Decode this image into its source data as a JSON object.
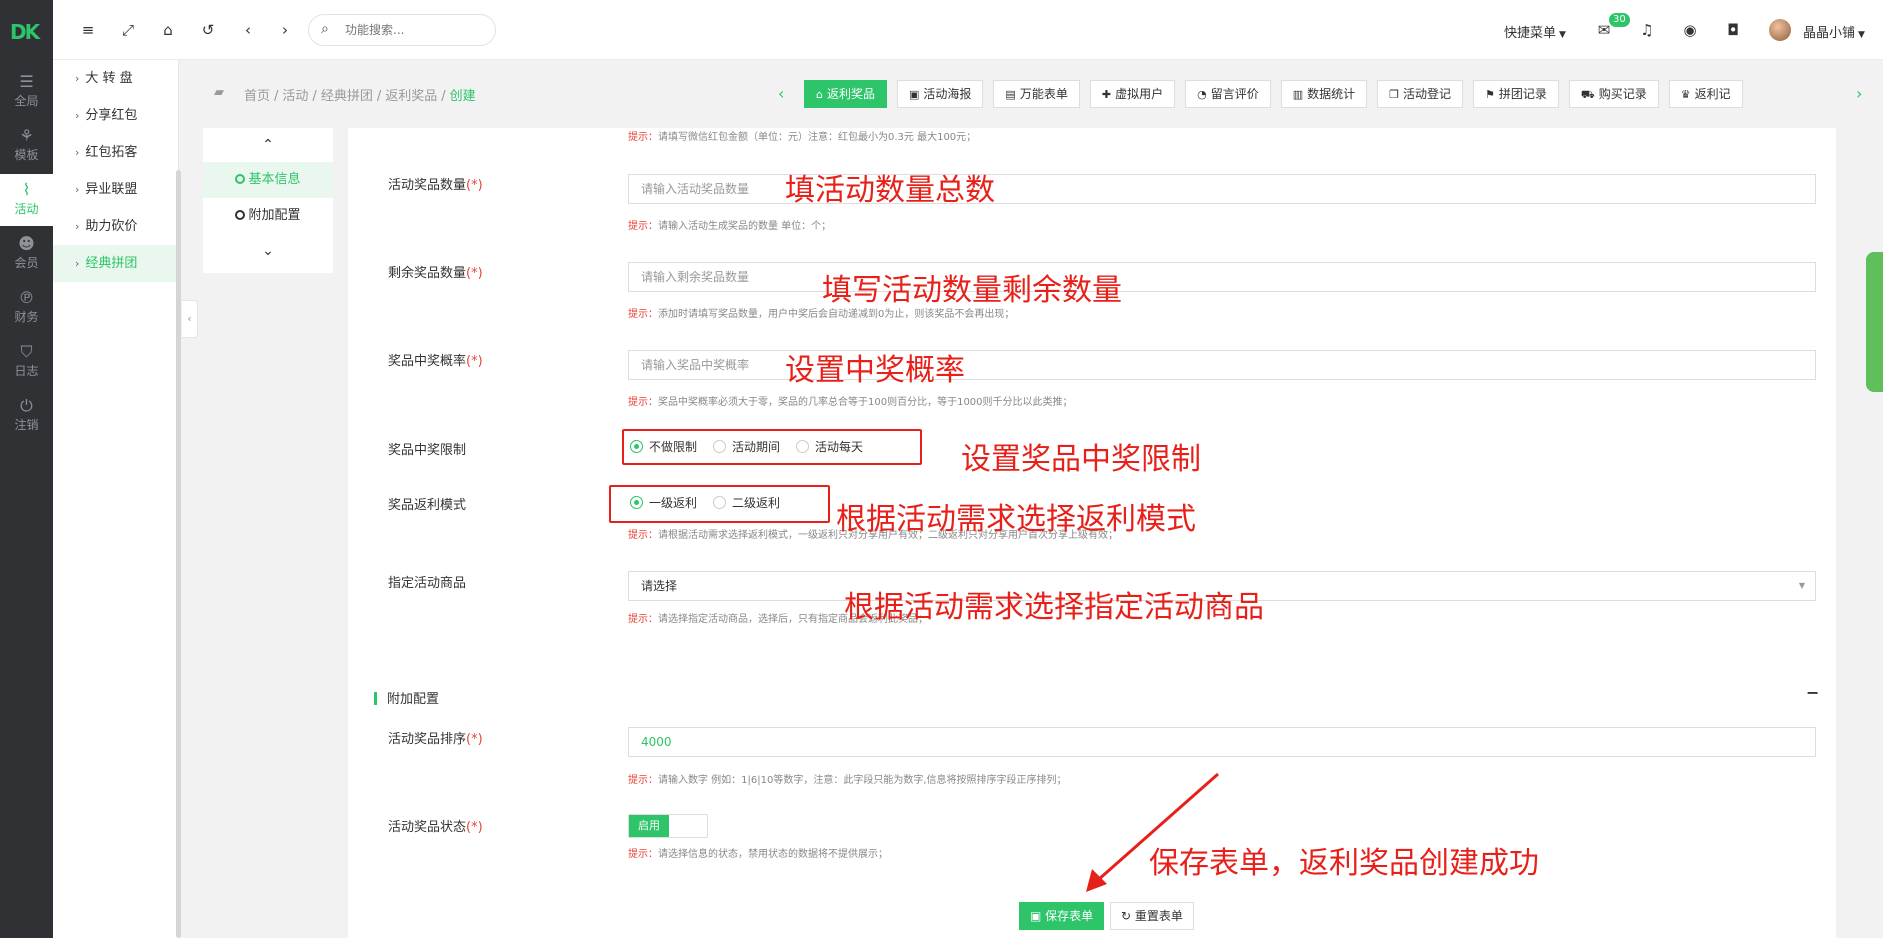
{
  "app": {
    "logo_text": "DK"
  },
  "rail": [
    {
      "label": "全局",
      "icon": "sliders-icon"
    },
    {
      "label": "模板",
      "icon": "sitemap-icon"
    },
    {
      "label": "活动",
      "icon": "activity-icon"
    },
    {
      "label": "会员",
      "icon": "users-icon"
    },
    {
      "label": "财务",
      "icon": "paypal-icon"
    },
    {
      "label": "日志",
      "icon": "shield-icon"
    },
    {
      "label": "注销",
      "icon": "power-icon"
    }
  ],
  "submenu": [
    {
      "label": "大 转 盘"
    },
    {
      "label": "分享红包"
    },
    {
      "label": "红包拓客"
    },
    {
      "label": "异业联盟"
    },
    {
      "label": "助力砍价"
    },
    {
      "label": "经典拼团"
    }
  ],
  "topbar": {
    "search_placeholder": "功能搜索...",
    "quick_menu": "快捷菜单",
    "mail_badge": "30",
    "user_name": "晶晶小铺"
  },
  "breadcrumb": {
    "items": [
      "首页",
      "活动",
      "经典拼团",
      "返利奖品"
    ],
    "current": "创建",
    "sep": "/"
  },
  "tabs": [
    {
      "label": "返利奖品",
      "icon": "home-icon"
    },
    {
      "label": "活动海报",
      "icon": "image-icon"
    },
    {
      "label": "万能表单",
      "icon": "file-icon"
    },
    {
      "label": "虚拟用户",
      "icon": "user-plus-icon"
    },
    {
      "label": "留言评价",
      "icon": "comment-icon"
    },
    {
      "label": "数据统计",
      "icon": "bar-chart-icon"
    },
    {
      "label": "活动登记",
      "icon": "copy-icon"
    },
    {
      "label": "拼团记录",
      "icon": "flag-icon"
    },
    {
      "label": "购买记录",
      "icon": "cart-icon"
    },
    {
      "label": "返利记",
      "icon": "trophy-icon"
    }
  ],
  "anchor": {
    "items": [
      "基本信息",
      "附加配置"
    ]
  },
  "form": {
    "top_hint": {
      "key": "提示：",
      "text": "请填写微信红包金额（单位：元）注意：红包最小为0.3元 最大100元；"
    },
    "prize_count": {
      "label": "活动奖品数量",
      "req": "(*)",
      "placeholder": "请输入活动奖品数量",
      "hint_key": "提示：",
      "hint": "请输入活动生成奖品的数量 单位：个；"
    },
    "remain_count": {
      "label": "剩余奖品数量",
      "req": "(*)",
      "placeholder": "请输入剩余奖品数量",
      "hint_key": "提示：",
      "hint": "添加时请填写奖品数量，用户中奖后会自动递减到0为止，则该奖品不会再出现；"
    },
    "win_rate": {
      "label": "奖品中奖概率",
      "req": "(*)",
      "placeholder": "请输入奖品中奖概率",
      "hint_key": "提示：",
      "hint": "奖品中奖概率必须大于零，奖品的几率总合等于100则百分比，等于1000则千分比以此类推；"
    },
    "win_limit": {
      "label": "奖品中奖限制",
      "options": [
        "不做限制",
        "活动期间",
        "活动每天"
      ],
      "selected": "不做限制"
    },
    "rebate_mode": {
      "label": "奖品返利模式",
      "options": [
        "一级返利",
        "二级返利"
      ],
      "selected": "一级返利",
      "hint_key": "提示：",
      "hint": "请根据活动需求选择返利模式，一级返利只对分享用户有效；二级返利只对分享用户首次分享上级有效；"
    },
    "goods": {
      "label": "指定活动商品",
      "value": "请选择",
      "hint_key": "提示：",
      "hint": "请选择指定活动商品，选择后，只有指定商品会返利此奖品；"
    },
    "section_extra": {
      "title": "附加配置",
      "toggle": "−"
    },
    "sort": {
      "label": "活动奖品排序",
      "req": "(*)",
      "value": "4000",
      "hint_key": "提示：",
      "hint": "请输入数字 例如：1|6|10等数字，注意：此字段只能为数字,信息将按照排序字段正序排列；"
    },
    "status": {
      "label": "活动奖品状态",
      "req": "(*)",
      "switch_label": "启用",
      "hint_key": "提示：",
      "hint": "请选择信息的状态，禁用状态的数据将不提供展示；"
    },
    "save_button": "保存表单",
    "reset_button": "重置表单"
  },
  "annotations": {
    "n1": "填活动数量总数",
    "n2": "填写活动数量剩余数量",
    "n3": "设置中奖概率",
    "n4": "设置奖品中奖限制",
    "n5": "根据活动需求选择返利模式",
    "n6": "根据活动需求选择指定活动商品",
    "n7": "保存表单，返利奖品创建成功",
    "color": "#e8201a"
  },
  "colors": {
    "accent": "#2dc46a",
    "rail": "#2f3135"
  }
}
